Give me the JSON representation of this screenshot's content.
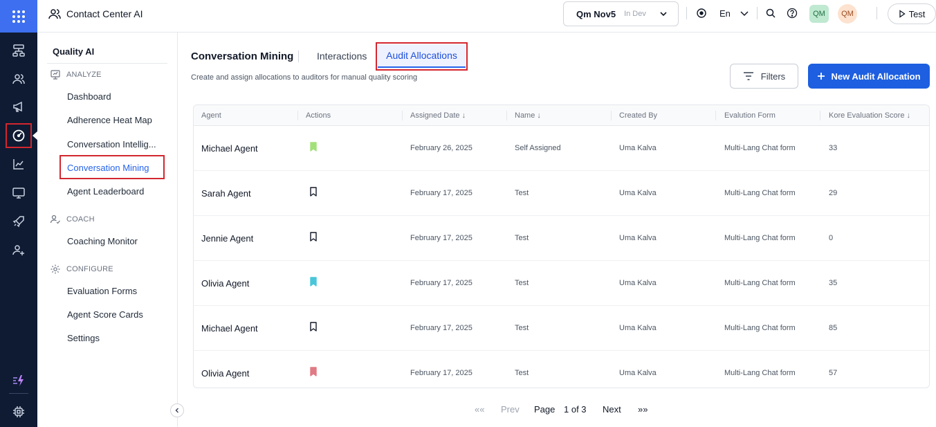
{
  "app": {
    "title": "Contact Center AI"
  },
  "env": {
    "name": "Qm Nov5",
    "tag": "In Dev"
  },
  "topbar": {
    "language": "En",
    "avatar1": "QM",
    "avatar2": "QM",
    "test_label": "Test"
  },
  "nav": {
    "title": "Quality AI",
    "analyze": "ANALYZE",
    "analyze_items": [
      "Dashboard",
      "Adherence Heat Map",
      "Conversation Intellig...",
      "Conversation Mining",
      "Agent Leaderboard"
    ],
    "coach": "COACH",
    "coach_items": [
      "Coaching Monitor"
    ],
    "configure": "CONFIGURE",
    "configure_items": [
      "Evaluation Forms",
      "Agent Score Cards",
      "Settings"
    ]
  },
  "main": {
    "title": "Conversation Mining",
    "tabs": [
      "Interactions",
      "Audit Allocations"
    ],
    "subtitle": "Create and assign allocations to auditors for manual quality scoring",
    "filters_label": "Filters",
    "new_label": "New Audit Allocation"
  },
  "table": {
    "headers": [
      "Agent",
      "Actions",
      "Assigned Date ↓",
      "Name ↓",
      "Created By",
      "Evalution Form",
      "Kore Evaluation Score ↓"
    ],
    "rows": [
      {
        "agent": "Michael Agent",
        "bookmark": "#a3e07a",
        "filled": true,
        "date": "February 26, 2025",
        "name": "Self Assigned",
        "created_by": "Uma Kalva",
        "form": "Multi-Lang Chat form",
        "score": "33"
      },
      {
        "agent": "Sarah Agent",
        "bookmark": "#111827",
        "filled": false,
        "date": "February 17, 2025",
        "name": "Test",
        "created_by": "Uma Kalva",
        "form": "Multi-Lang Chat form",
        "score": "29"
      },
      {
        "agent": "Jennie Agent",
        "bookmark": "#111827",
        "filled": false,
        "date": "February 17, 2025",
        "name": "Test",
        "created_by": "Uma Kalva",
        "form": "Multi-Lang Chat form",
        "score": "0"
      },
      {
        "agent": "Olivia Agent",
        "bookmark": "#49c6d9",
        "filled": true,
        "date": "February 17, 2025",
        "name": "Test",
        "created_by": "Uma Kalva",
        "form": "Multi-Lang Chat form",
        "score": "35"
      },
      {
        "agent": "Michael Agent",
        "bookmark": "#111827",
        "filled": false,
        "date": "February 17, 2025",
        "name": "Test",
        "created_by": "Uma Kalva",
        "form": "Multi-Lang Chat form",
        "score": "85"
      },
      {
        "agent": "Olivia Agent",
        "bookmark": "#e07a84",
        "filled": true,
        "date": "February 17, 2025",
        "name": "Test",
        "created_by": "Uma Kalva",
        "form": "Multi-Lang Chat form",
        "score": "57"
      }
    ]
  },
  "pagination": {
    "first": "««",
    "prev": "Prev",
    "page_label": "Page",
    "page_value": "1 of 3",
    "next": "Next",
    "last": "»»"
  },
  "icons": {
    "rail": [
      "apps-grid-icon",
      "flow-icon",
      "users-icon",
      "megaphone-icon",
      "gauge-icon",
      "chart-icon",
      "monitor-icon",
      "rocket-icon",
      "user-plus-icon",
      "bolt-icon",
      "chip-icon"
    ]
  }
}
